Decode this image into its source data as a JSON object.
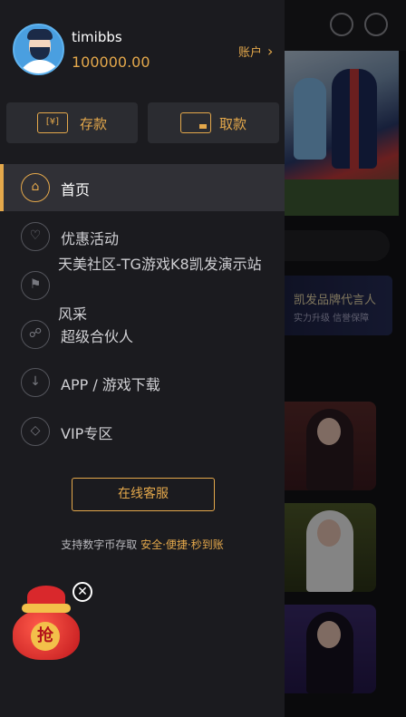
{
  "profile": {
    "username": "timibbs",
    "balance": "100000.00",
    "account_label": "账户"
  },
  "actions": {
    "deposit_label": "存款",
    "deposit_icon_text": "[¥]",
    "withdraw_label": "取款"
  },
  "menu": {
    "items": [
      {
        "label": "首页",
        "icon": "home-icon",
        "active": true
      },
      {
        "label": "优惠活动",
        "icon": "heart-icon",
        "active": false
      },
      {
        "label": "",
        "icon": "flag-icon",
        "active": false
      },
      {
        "label": "超级合伙人",
        "icon": "partner-icon",
        "active": false
      },
      {
        "label": "APP / 游戏下载",
        "icon": "download-icon",
        "active": false
      },
      {
        "label": "VIP专区",
        "icon": "diamond-icon",
        "active": false
      }
    ],
    "overflow_line1": "天美社区-TG游戏K8凯发演示站",
    "overflow_line2": "风采"
  },
  "service": {
    "button_label": "在线客服"
  },
  "crypto_note": {
    "prefix": "支持数字币存取 ",
    "highlight": "安全·便捷·秒到账"
  },
  "background": {
    "ad_title": "凯发品牌代言人",
    "ad_subtitle": "实力升级 信誉保障"
  },
  "red_packet": {
    "char": "抢",
    "close_symbol": "✕"
  },
  "colors": {
    "accent": "#e4a84b",
    "drawer_bg": "#1b1b1f",
    "active_item_bg": "#303036"
  }
}
